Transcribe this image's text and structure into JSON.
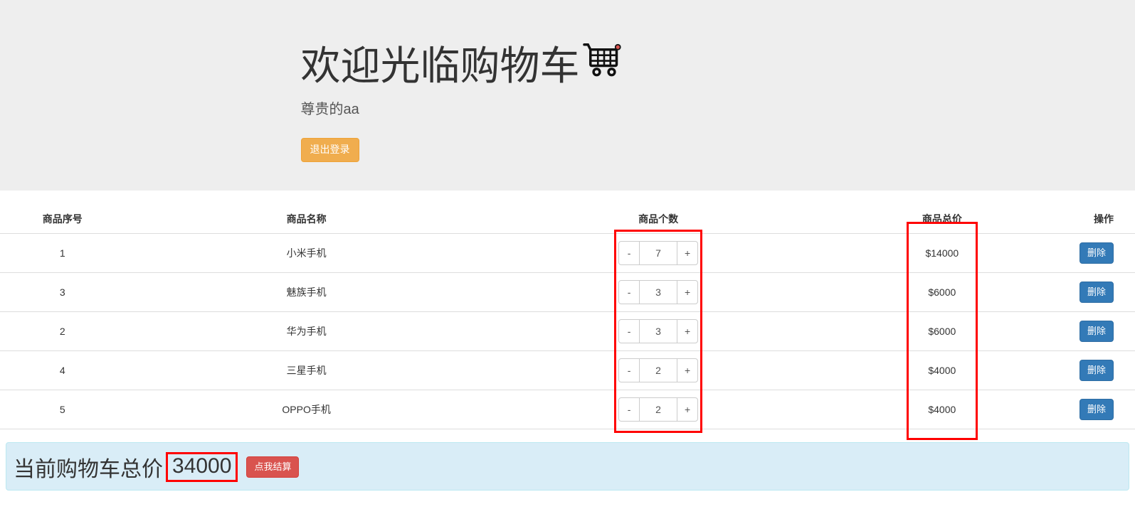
{
  "header": {
    "title": "欢迎光临购物车",
    "subtitle": "尊贵的aa",
    "logout_label": "退出登录"
  },
  "table": {
    "columns": [
      "商品序号",
      "商品名称",
      "商品个数",
      "商品总价",
      "操作"
    ],
    "rows": [
      {
        "id": "1",
        "name": "小米手机",
        "qty": "7",
        "subtotal": "$14000"
      },
      {
        "id": "3",
        "name": "魅族手机",
        "qty": "3",
        "subtotal": "$6000"
      },
      {
        "id": "2",
        "name": "华为手机",
        "qty": "3",
        "subtotal": "$6000"
      },
      {
        "id": "4",
        "name": "三星手机",
        "qty": "2",
        "subtotal": "$4000"
      },
      {
        "id": "5",
        "name": "OPPO手机",
        "qty": "2",
        "subtotal": "$4000"
      }
    ],
    "minus_label": "-",
    "plus_label": "+",
    "delete_label": "删除"
  },
  "footer": {
    "total_label": "当前购物车总价",
    "total_value": "34000",
    "checkout_label": "点我结算"
  }
}
